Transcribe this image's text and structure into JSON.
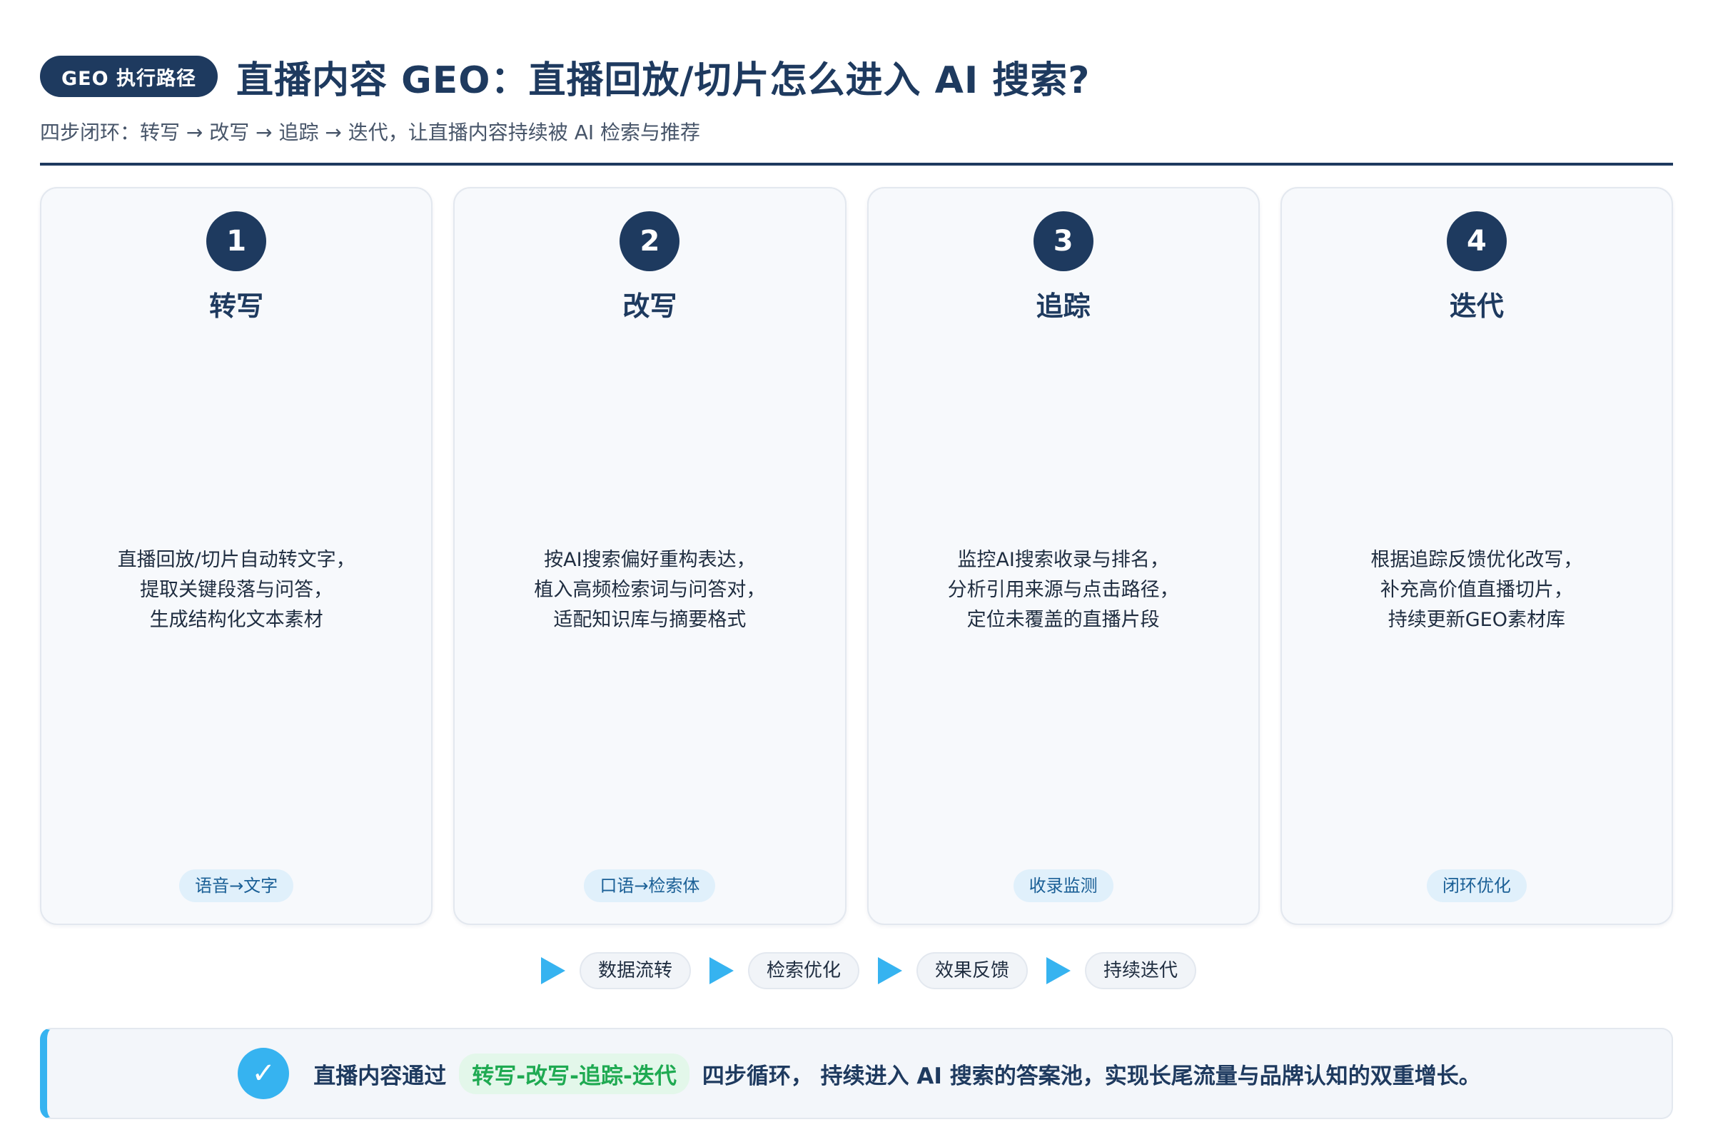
{
  "header": {
    "badge": "GEO 执行路径",
    "title": "直播内容 GEO：直播回放/切片怎么进入 AI 搜索?",
    "subtitle": "四步闭环：转写 → 改写 → 追踪 → 迭代，让直播内容持续被 AI 检索与推荐"
  },
  "steps": [
    {
      "number": "1",
      "title": "转写",
      "desc": [
        "直播回放/切片自动转文字，",
        "提取关键段落与问答，",
        "生成结构化文本素材"
      ],
      "tag": "语音→文字"
    },
    {
      "number": "2",
      "title": "改写",
      "desc": [
        "按AI搜索偏好重构表达，",
        "植入高频检索词与问答对，",
        "适配知识库与摘要格式"
      ],
      "tag": "口语→检索体"
    },
    {
      "number": "3",
      "title": "追踪",
      "desc": [
        "监控AI搜索收录与排名，",
        "分析引用来源与点击路径，",
        "定位未覆盖的直播片段"
      ],
      "tag": "收录监测"
    },
    {
      "number": "4",
      "title": "迭代",
      "desc": [
        "根据追踪反馈优化改写，",
        "补充高价值直播切片，",
        "持续更新GEO素材库"
      ],
      "tag": "闭环优化"
    }
  ],
  "flow": [
    "数据流转",
    "检索优化",
    "效果反馈",
    "持续迭代"
  ],
  "summary": {
    "prefix": "直播内容通过",
    "highlight": "转写-改写-追踪-迭代",
    "suffix": "四步循环， 持续进入 AI 搜索的答案池，实现长尾流量与品牌认知的双重增长。"
  },
  "colors": {
    "primary": "#1e3a5f",
    "accent": "#36b3f0",
    "highlight": "#1faa52"
  }
}
